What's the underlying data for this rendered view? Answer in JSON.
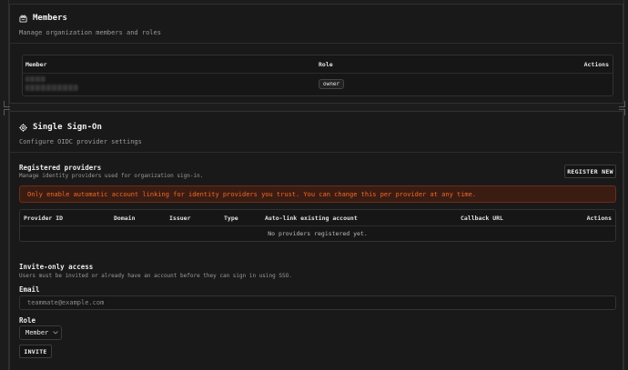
{
  "members": {
    "title": "Members",
    "subtitle": "Manage organization members and roles",
    "columns": {
      "member": "Member",
      "role": "Role",
      "actions": "Actions"
    },
    "rows": [
      {
        "role": "owner"
      }
    ]
  },
  "sso": {
    "title": "Single Sign-On",
    "subtitle": "Configure OIDC provider settings",
    "providers": {
      "heading": "Registered providers",
      "hint": "Manage identity providers used for organization sign-in.",
      "register_button": "REGISTER NEW",
      "alert": "Only enable automatic account linking for identity providers you trust. You can change this per provider at any time.",
      "columns": {
        "provider_id": "Provider ID",
        "domain": "Domain",
        "issuer": "Issuer",
        "type": "Type",
        "autolink": "Auto-link existing account",
        "callback": "Callback URL",
        "actions": "Actions"
      },
      "empty": "No providers registered yet."
    },
    "invite": {
      "heading": "Invite-only access",
      "hint": "Users must be invited or already have an account before they can sign in using SSO.",
      "email_label": "Email",
      "email_placeholder": "teammate@example.com",
      "role_label": "Role",
      "role_value": "Member",
      "invite_button": "INVITE"
    }
  },
  "colors": {
    "background": "#1c1c1c",
    "alert_text": "#f06a2a",
    "alert_bg": "#3a1c12"
  },
  "icons": {
    "members": "members-icon",
    "sso": "gear-icon",
    "role_select": "chevron-down-icon"
  }
}
